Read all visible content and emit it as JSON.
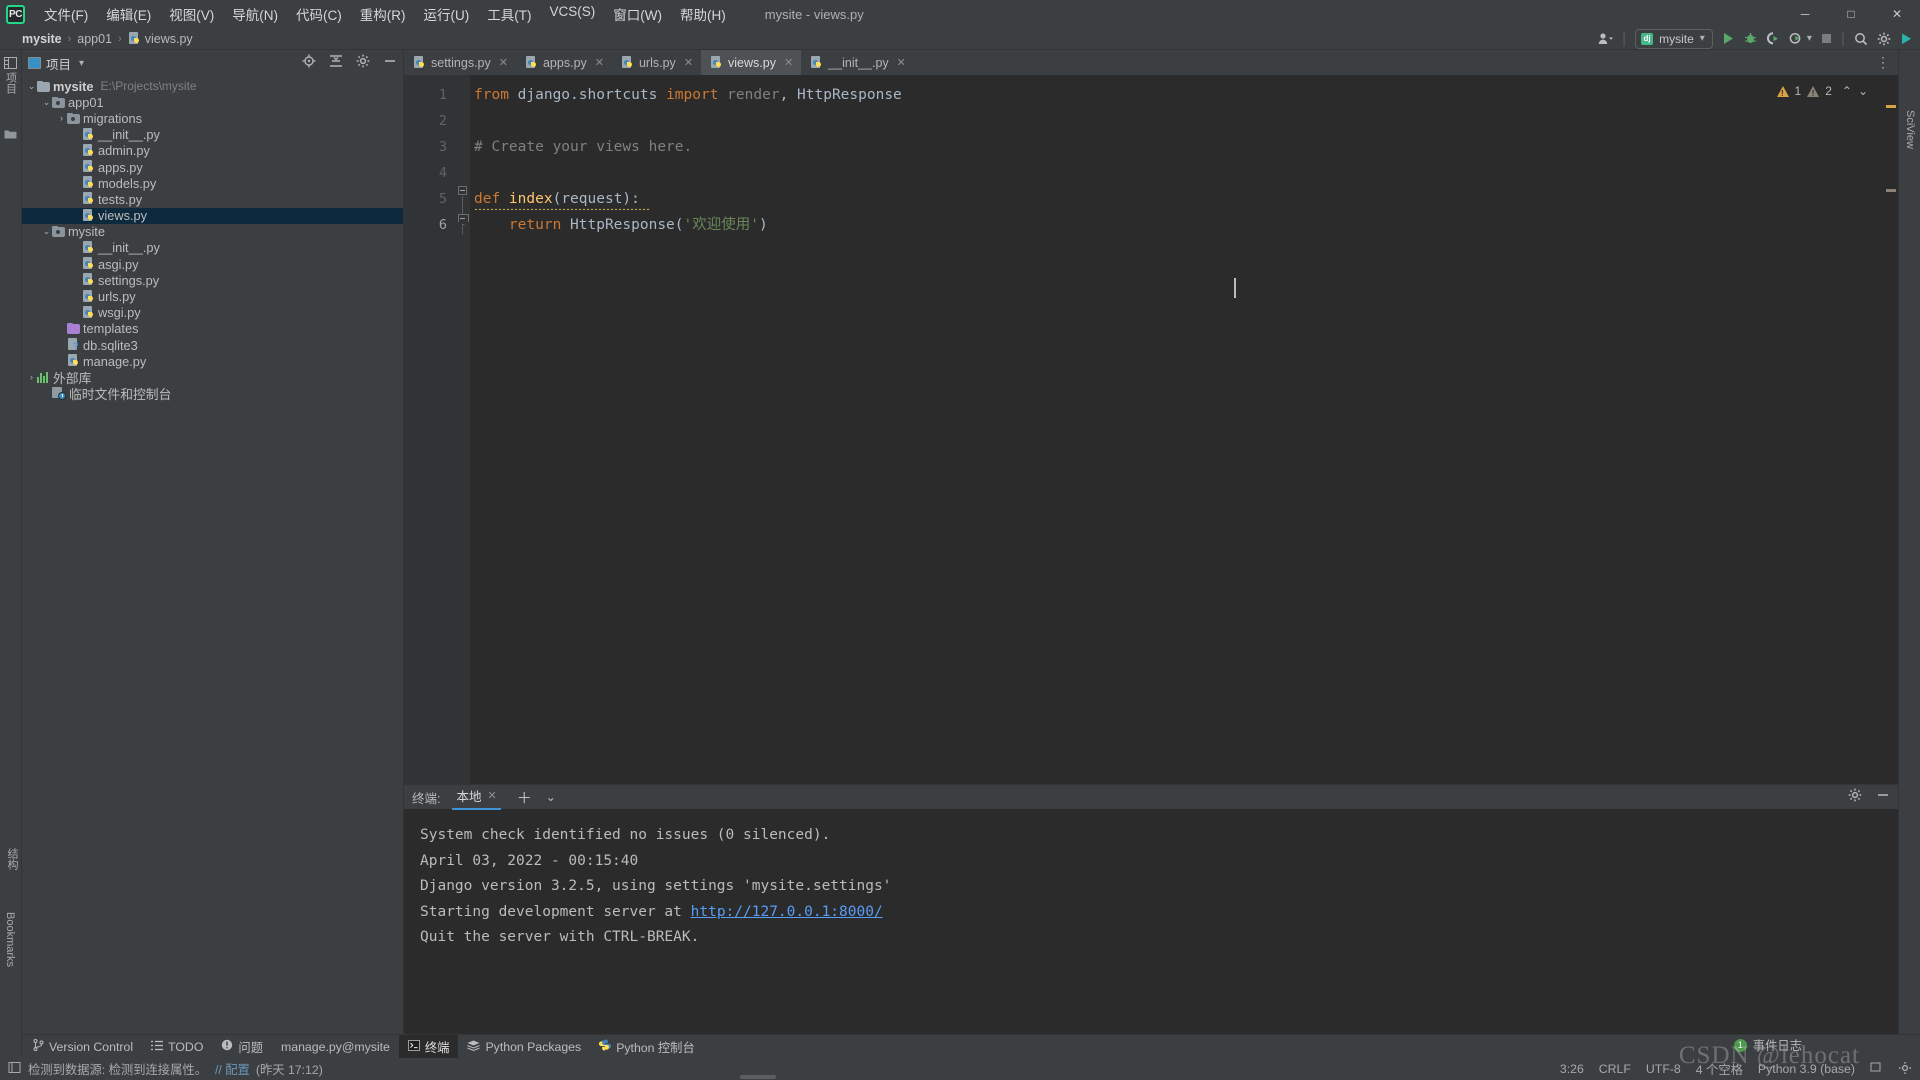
{
  "window": {
    "title": "mysite - views.py",
    "controls": {
      "minimize": "─",
      "maximize": "□",
      "close": "✕"
    }
  },
  "menu": {
    "logo": "PC",
    "items": [
      "文件(F)",
      "编辑(E)",
      "视图(V)",
      "导航(N)",
      "代码(C)",
      "重构(R)",
      "运行(U)",
      "工具(T)",
      "VCS(S)",
      "窗口(W)",
      "帮助(H)"
    ]
  },
  "breadcrumb": {
    "items": [
      "mysite",
      "app01",
      "views.py"
    ],
    "separator": "›"
  },
  "toolbar_right": {
    "run_config": "mysite",
    "run_config_icon": "django-icon",
    "buttons": [
      "run-button",
      "debug-button",
      "run-coverage-button",
      "profile-button",
      "stop-button",
      "search-everywhere-button",
      "settings-button",
      "updates-button"
    ]
  },
  "project_panel": {
    "title": "项目",
    "header_icons": [
      "locate-icon",
      "collapse-all-icon",
      "settings-icon",
      "hide-icon"
    ],
    "tree": [
      {
        "indent": 0,
        "arrow": "⌄",
        "icon": "folder",
        "label": "mysite",
        "bold": true,
        "path": "E:\\Projects\\mysite",
        "selected": false
      },
      {
        "indent": 1,
        "arrow": "⌄",
        "icon": "folder-src",
        "label": "app01",
        "bold": false,
        "path": "",
        "selected": false
      },
      {
        "indent": 2,
        "arrow": "›",
        "icon": "folder-src",
        "label": "migrations",
        "bold": false,
        "path": "",
        "selected": false
      },
      {
        "indent": 3,
        "arrow": "",
        "icon": "python",
        "label": "__init__.py",
        "bold": false,
        "path": "",
        "selected": false
      },
      {
        "indent": 3,
        "arrow": "",
        "icon": "python",
        "label": "admin.py",
        "bold": false,
        "path": "",
        "selected": false
      },
      {
        "indent": 3,
        "arrow": "",
        "icon": "python",
        "label": "apps.py",
        "bold": false,
        "path": "",
        "selected": false
      },
      {
        "indent": 3,
        "arrow": "",
        "icon": "python",
        "label": "models.py",
        "bold": false,
        "path": "",
        "selected": false
      },
      {
        "indent": 3,
        "arrow": "",
        "icon": "python",
        "label": "tests.py",
        "bold": false,
        "path": "",
        "selected": false
      },
      {
        "indent": 3,
        "arrow": "",
        "icon": "python",
        "label": "views.py",
        "bold": false,
        "path": "",
        "selected": true
      },
      {
        "indent": 1,
        "arrow": "⌄",
        "icon": "folder-src",
        "label": "mysite",
        "bold": false,
        "path": "",
        "selected": false
      },
      {
        "indent": 3,
        "arrow": "",
        "icon": "python",
        "label": "__init__.py",
        "bold": false,
        "path": "",
        "selected": false
      },
      {
        "indent": 3,
        "arrow": "",
        "icon": "python",
        "label": "asgi.py",
        "bold": false,
        "path": "",
        "selected": false
      },
      {
        "indent": 3,
        "arrow": "",
        "icon": "python",
        "label": "settings.py",
        "bold": false,
        "path": "",
        "selected": false
      },
      {
        "indent": 3,
        "arrow": "",
        "icon": "python",
        "label": "urls.py",
        "bold": false,
        "path": "",
        "selected": false
      },
      {
        "indent": 3,
        "arrow": "",
        "icon": "python",
        "label": "wsgi.py",
        "bold": false,
        "path": "",
        "selected": false
      },
      {
        "indent": 2,
        "arrow": "",
        "icon": "folder-purple",
        "label": "templates",
        "bold": false,
        "path": "",
        "selected": false
      },
      {
        "indent": 2,
        "arrow": "",
        "icon": "db",
        "label": "db.sqlite3",
        "bold": false,
        "path": "",
        "selected": false
      },
      {
        "indent": 2,
        "arrow": "",
        "icon": "python",
        "label": "manage.py",
        "bold": false,
        "path": "",
        "selected": false
      },
      {
        "indent": 0,
        "arrow": "›",
        "icon": "library",
        "label": "外部库",
        "bold": false,
        "path": "",
        "selected": false
      },
      {
        "indent": 1,
        "arrow": "",
        "icon": "scratch",
        "label": "临时文件和控制台",
        "bold": false,
        "path": "",
        "selected": false
      }
    ]
  },
  "left_strip": {
    "labels": [
      "项目"
    ]
  },
  "right_strip": {
    "labels": [
      "SciView"
    ]
  },
  "editor": {
    "tabs": [
      {
        "label": "settings.py",
        "active": false
      },
      {
        "label": "apps.py",
        "active": false
      },
      {
        "label": "urls.py",
        "active": false
      },
      {
        "label": "views.py",
        "active": true
      },
      {
        "label": "__init__.py",
        "active": false
      }
    ],
    "tab_close_glyph": "✕",
    "overflow_glyph": "⋮",
    "gutter_lines": [
      "1",
      "2",
      "3",
      "4",
      "5",
      "6"
    ],
    "current_line": 6,
    "inspections": {
      "warning_count": "1",
      "weak_warning_count": "2",
      "up_glyph": "⌃",
      "down_glyph": "⌄"
    },
    "code_lines": [
      {
        "n": 1,
        "tokens": [
          {
            "t": "from ",
            "c": "kw"
          },
          {
            "t": "django.shortcuts ",
            "c": "plain"
          },
          {
            "t": "import ",
            "c": "kw"
          },
          {
            "t": "render",
            "c": "cmt"
          },
          {
            "t": ", ",
            "c": "plain"
          },
          {
            "t": "HttpResponse",
            "c": "plain"
          }
        ]
      },
      {
        "n": 2,
        "tokens": []
      },
      {
        "n": 3,
        "tokens": [
          {
            "t": "# Create your views here.",
            "c": "cmt"
          }
        ]
      },
      {
        "n": 4,
        "tokens": []
      },
      {
        "n": 5,
        "tokens": [
          {
            "t": "def ",
            "c": "kw"
          },
          {
            "t": "index",
            "c": "def"
          },
          {
            "t": "(",
            "c": "plain"
          },
          {
            "t": "request",
            "c": "cls"
          },
          {
            "t": "):",
            "c": "plain"
          }
        ]
      },
      {
        "n": 6,
        "tokens": [
          {
            "t": "    ",
            "c": "plain"
          },
          {
            "t": "return ",
            "c": "kw"
          },
          {
            "t": "HttpResponse",
            "c": "plain"
          },
          {
            "t": "(",
            "c": "plain"
          },
          {
            "t": "'欢迎使用'",
            "c": "str"
          },
          {
            "t": ")",
            "c": "plain"
          }
        ]
      }
    ]
  },
  "terminal": {
    "label": "终端:",
    "tab": "本地",
    "close_glyph": "✕",
    "add_glyph": "＋",
    "dropdown_glyph": "⌄",
    "settings_icon": "gear-icon",
    "hide_icon": "minimize-icon",
    "lines": [
      {
        "text": "System check identified no issues (0 silenced).",
        "link": ""
      },
      {
        "text": "April 03, 2022 - 00:15:40",
        "link": ""
      },
      {
        "text": "Django version 3.2.5, using settings 'mysite.settings'",
        "link": ""
      },
      {
        "text": "Starting development server at ",
        "link": "http://127.0.0.1:8000/"
      },
      {
        "text": "Quit the server with CTRL-BREAK.",
        "link": ""
      }
    ]
  },
  "tool_window_bar": [
    {
      "label": "Version Control",
      "icon": "branch-icon",
      "active": false
    },
    {
      "label": "TODO",
      "icon": "list-icon",
      "active": false
    },
    {
      "label": "问题",
      "icon": "warning-icon",
      "active": false
    },
    {
      "label": "manage.py@mysite",
      "icon": "",
      "active": false
    },
    {
      "label": "终端",
      "icon": "terminal-icon",
      "active": true
    },
    {
      "label": "Python Packages",
      "icon": "packages-icon",
      "active": false
    },
    {
      "label": "Python 控制台",
      "icon": "python-console-icon",
      "active": false
    }
  ],
  "bottom_left_strips": [
    "结构",
    "Bookmarks"
  ],
  "status_bar": {
    "message_icon": "notification-icon",
    "message": "检测到数据源: 检测到连接属性。",
    "config_link": "// 配置",
    "timestamp": "(昨天 17:12)",
    "caret_position": "3:26",
    "line_separator": "CRLF",
    "encoding": "UTF-8",
    "indent": "4 个空格",
    "interpreter": "Python 3.9 (base)",
    "event_log": "事件日志",
    "event_log_count": "1"
  },
  "watermark": "CSDN @lehocat",
  "colors": {
    "accent_blue": "#3d92d8",
    "selection": "#0d293e",
    "editor_bg": "#2b2b2b",
    "panel_bg": "#3c3f41",
    "keyword": "#cc7832",
    "string": "#6a8759",
    "function": "#ffc66d",
    "comment": "#808080",
    "warning": "#d9a343",
    "link": "#589df6"
  }
}
